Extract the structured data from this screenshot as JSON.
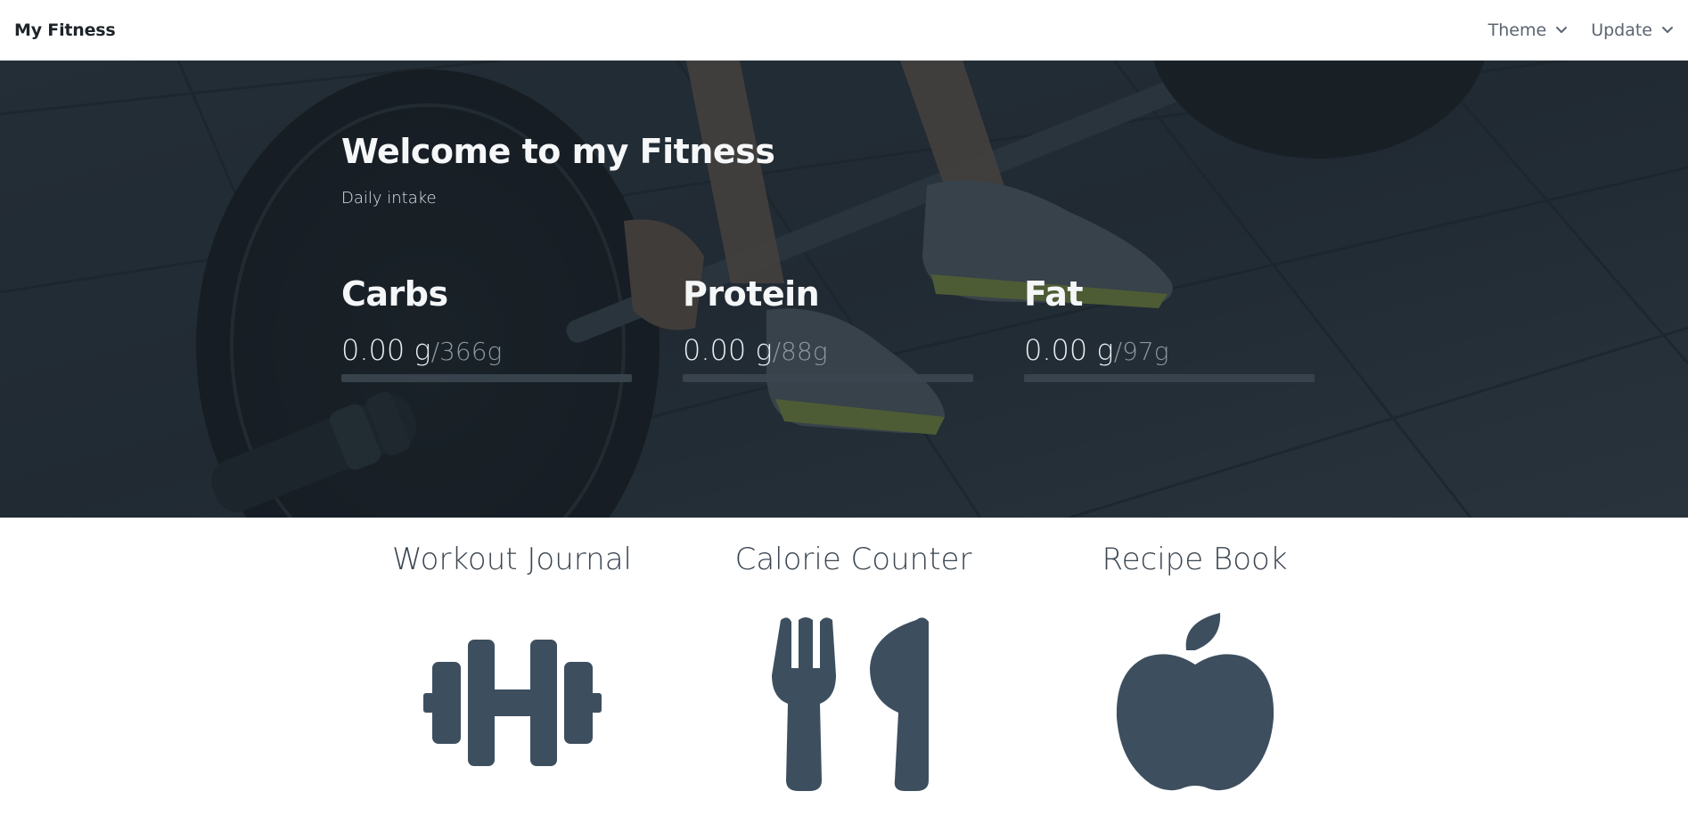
{
  "navbar": {
    "brand": "My Fitness",
    "menus": [
      {
        "label": "Theme",
        "icon": "chevron-down-icon"
      },
      {
        "label": "Update",
        "icon": "chevron-down-icon"
      }
    ]
  },
  "hero": {
    "title": "Welcome to my Fitness",
    "subtitle": "Daily intake",
    "macros": [
      {
        "name": "Carbs",
        "value": "0.00 g",
        "goal": "/366g",
        "progress": 0
      },
      {
        "name": "Protein",
        "value": "0.00 g",
        "goal": "/88g",
        "progress": 0
      },
      {
        "name": "Fat",
        "value": "0.00 g",
        "goal": "/97g",
        "progress": 0
      }
    ]
  },
  "cards": [
    {
      "title": "Workout Journal",
      "icon": "dumbbell-icon"
    },
    {
      "title": "Calorie Counter",
      "icon": "fork-knife-icon"
    },
    {
      "title": "Recipe Book",
      "icon": "apple-icon"
    }
  ],
  "colors": {
    "icon": "#3d4f5f",
    "hero_overlay": "#1c242b",
    "bar_track": "#3c4650"
  }
}
